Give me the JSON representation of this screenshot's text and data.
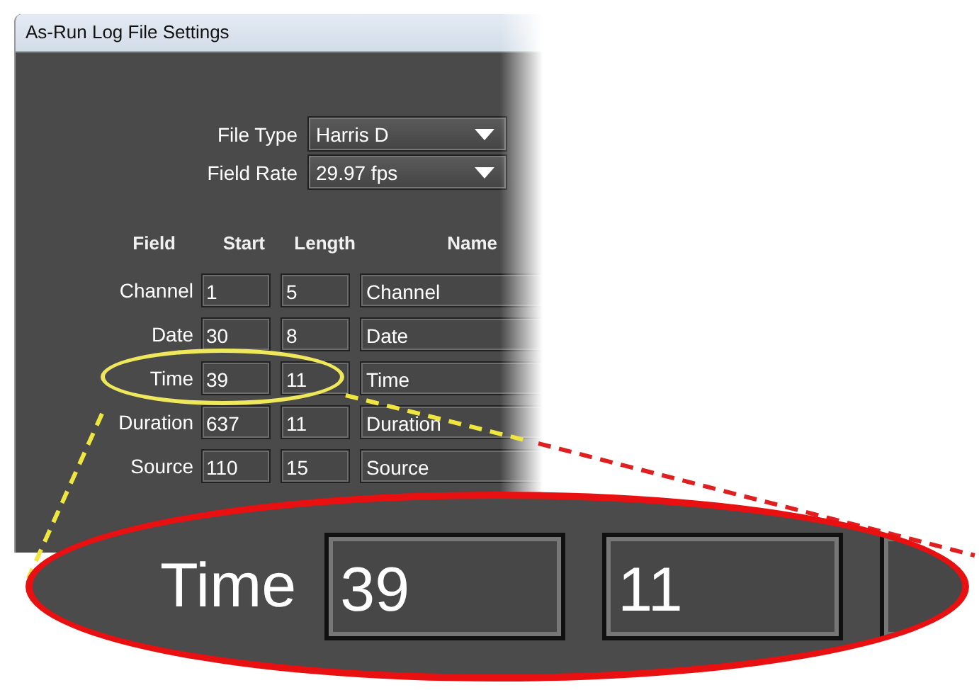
{
  "window": {
    "title": "As-Run Log File Settings"
  },
  "file_type": {
    "label": "File Type",
    "value": "Harris D"
  },
  "field_rate": {
    "label": "Field Rate",
    "value": "29.97 fps"
  },
  "table": {
    "columns": [
      "Field",
      "Start",
      "Length",
      "Name"
    ],
    "rows": [
      {
        "field": "Channel",
        "start": "1",
        "length": "5",
        "name": "Channel",
        "highlighted": false
      },
      {
        "field": "Date",
        "start": "30",
        "length": "8",
        "name": "Date",
        "highlighted": false
      },
      {
        "field": "Time",
        "start": "39",
        "length": "11",
        "name": "Time",
        "highlighted": true
      },
      {
        "field": "Duration",
        "start": "637",
        "length": "11",
        "name": "Duration",
        "highlighted": false
      },
      {
        "field": "Source",
        "start": "110",
        "length": "15",
        "name": "Source",
        "highlighted": false
      }
    ]
  },
  "callout": {
    "field": "Time",
    "start": "39",
    "length": "11"
  }
}
